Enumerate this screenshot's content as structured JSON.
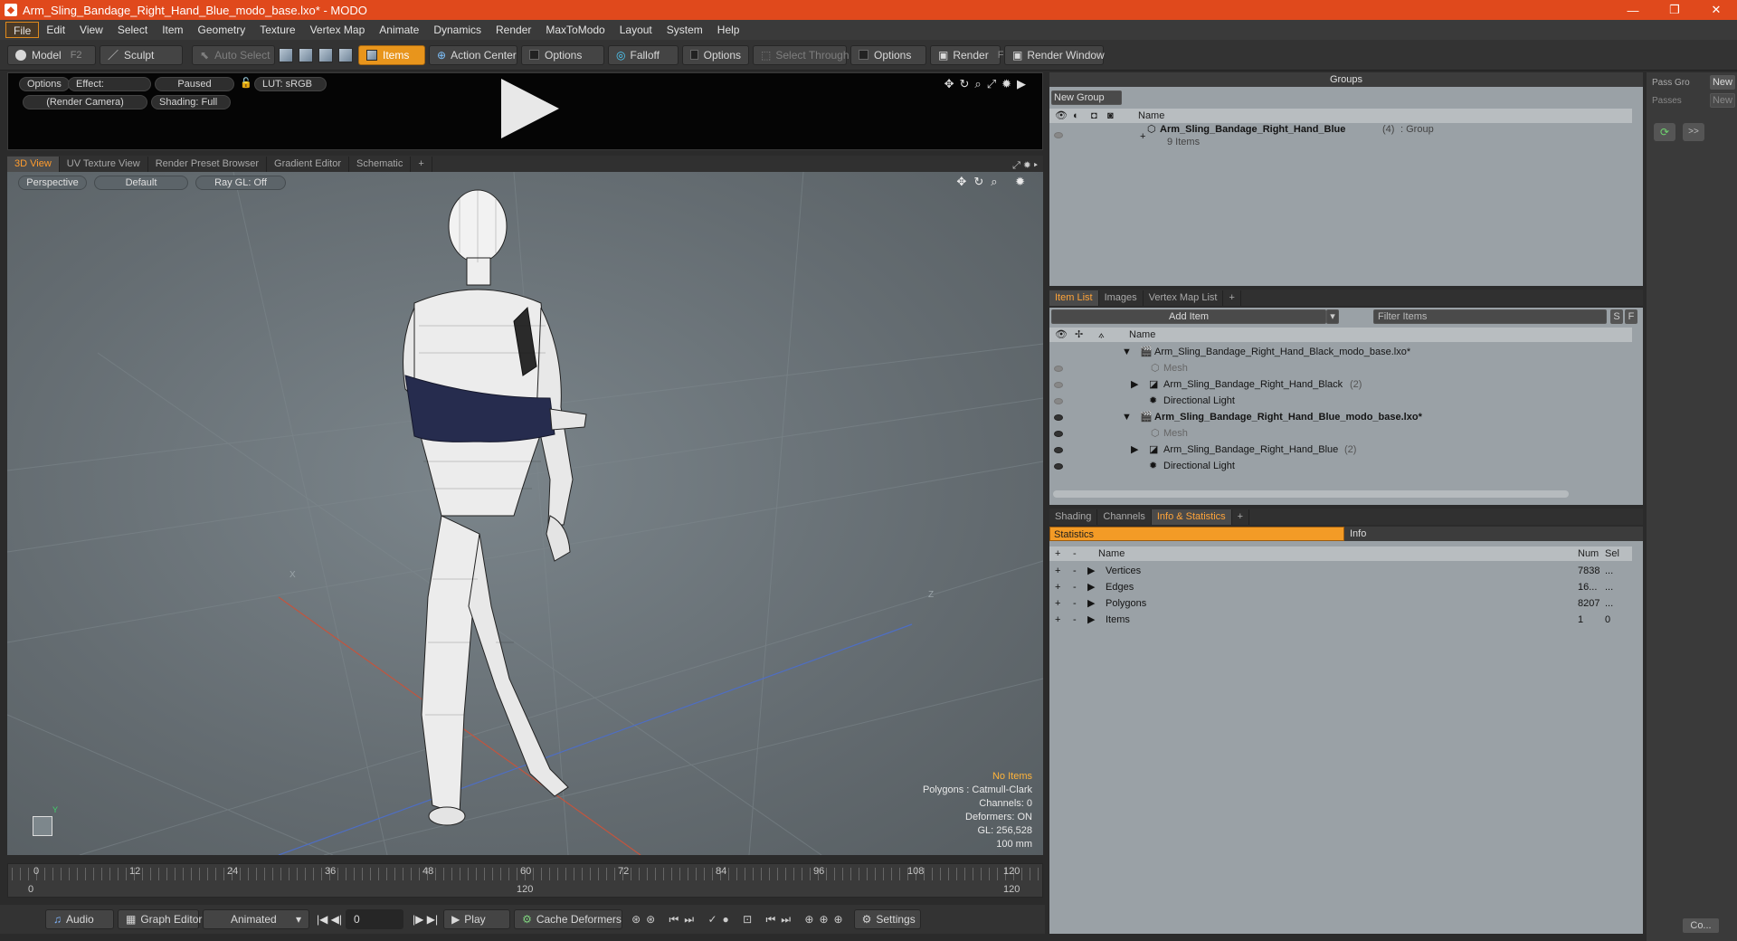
{
  "window": {
    "title": "Arm_Sling_Bandage_Right_Hand_Blue_modo_base.lxo* - MODO",
    "minimize": "—",
    "maximize": "❐",
    "close": "✕"
  },
  "menu": [
    "File",
    "Edit",
    "View",
    "Select",
    "Item",
    "Geometry",
    "Texture",
    "Vertex Map",
    "Animate",
    "Dynamics",
    "Render",
    "MaxToModo",
    "Layout",
    "System",
    "Help"
  ],
  "toolbar": {
    "model": "Model",
    "model_key": "F2",
    "sculpt": "Sculpt",
    "auto_select": "Auto Select",
    "items": "Items",
    "action_center": "Action Center",
    "options1": "Options",
    "falloff": "Falloff",
    "options2": "Options",
    "select_through": "Select Through",
    "options3": "Options",
    "render": "Render",
    "render_key": "F9",
    "render_window": "Render Window"
  },
  "preview": {
    "options": "Options",
    "effect": "Effect: (Shadi...",
    "paused": "Paused",
    "lut": "LUT: sRGB",
    "camera": "(Render Camera)",
    "shading": "Shading: Full"
  },
  "viewport_tabs": [
    "3D View",
    "UV Texture View",
    "Render Preset Browser",
    "Gradient Editor",
    "Schematic",
    "+"
  ],
  "viewport": {
    "perspective": "Perspective",
    "default": "Default",
    "raygl": "Ray GL: Off",
    "axis_x": "X",
    "axis_z": "Z",
    "gizmo_y": "Y",
    "info": {
      "no_items": "No Items",
      "polygons": "Polygons : Catmull-Clark",
      "channels": "Channels: 0",
      "deformers": "Deformers: ON",
      "gl": "GL: 256,528",
      "scale": "100 mm"
    }
  },
  "timeline": {
    "ticks": [
      "0",
      "12",
      "24",
      "36",
      "48",
      "60",
      "72",
      "84",
      "96",
      "108",
      "120"
    ],
    "sub_ticks": [
      "0",
      "120",
      "120"
    ]
  },
  "bottombar": {
    "audio": "Audio",
    "graph_editor": "Graph Editor",
    "animated": "Animated",
    "frame": "0",
    "play": "Play",
    "cache": "Cache Deformers",
    "settings": "Settings"
  },
  "groups": {
    "title": "Groups",
    "new_group": "New Group",
    "name_col": "Name",
    "group_name": "Arm_Sling_Bandage_Right_Hand_Blue",
    "group_count": "(4)",
    "group_type": ": Group",
    "group_items": "9 Items"
  },
  "pass": {
    "pass_label": "Pass Gro",
    "passes_label": "Passes",
    "new1": "New",
    "new2": "New",
    "arrows": ">>"
  },
  "item_list": {
    "tabs": [
      "Item List",
      "Images",
      "Vertex Map List",
      "+"
    ],
    "add_item": "Add Item",
    "filter_placeholder": "Filter Items",
    "s": "S",
    "f": "F",
    "name_col": "Name",
    "rows": [
      {
        "label": "Arm_Sling_Bandage_Right_Hand_Black_modo_base.lxo*",
        "count": ""
      },
      {
        "label": "Mesh",
        "count": ""
      },
      {
        "label": "Arm_Sling_Bandage_Right_Hand_Black",
        "count": "(2)"
      },
      {
        "label": "Directional Light",
        "count": ""
      },
      {
        "label": "Arm_Sling_Bandage_Right_Hand_Blue_modo_base.lxo*",
        "count": ""
      },
      {
        "label": "Mesh",
        "count": ""
      },
      {
        "label": "Arm_Sling_Bandage_Right_Hand_Blue",
        "count": "(2)"
      },
      {
        "label": "Directional Light",
        "count": ""
      }
    ]
  },
  "stats": {
    "tabs": [
      "Shading",
      "Channels",
      "Info & Statistics",
      "+"
    ],
    "stat_tab": "Statistics",
    "info_tab": "Info",
    "cols": {
      "plus": "+",
      "minus": "-",
      "name": "Name",
      "num": "Num",
      "sel": "Sel"
    },
    "rows": [
      {
        "name": "Vertices",
        "num": "7838",
        "sel": "..."
      },
      {
        "name": "Edges",
        "num": "16...",
        "sel": "..."
      },
      {
        "name": "Polygons",
        "num": "8207",
        "sel": "..."
      },
      {
        "name": "Items",
        "num": "1",
        "sel": "0"
      }
    ]
  },
  "strip": {
    "co": "Co..."
  }
}
